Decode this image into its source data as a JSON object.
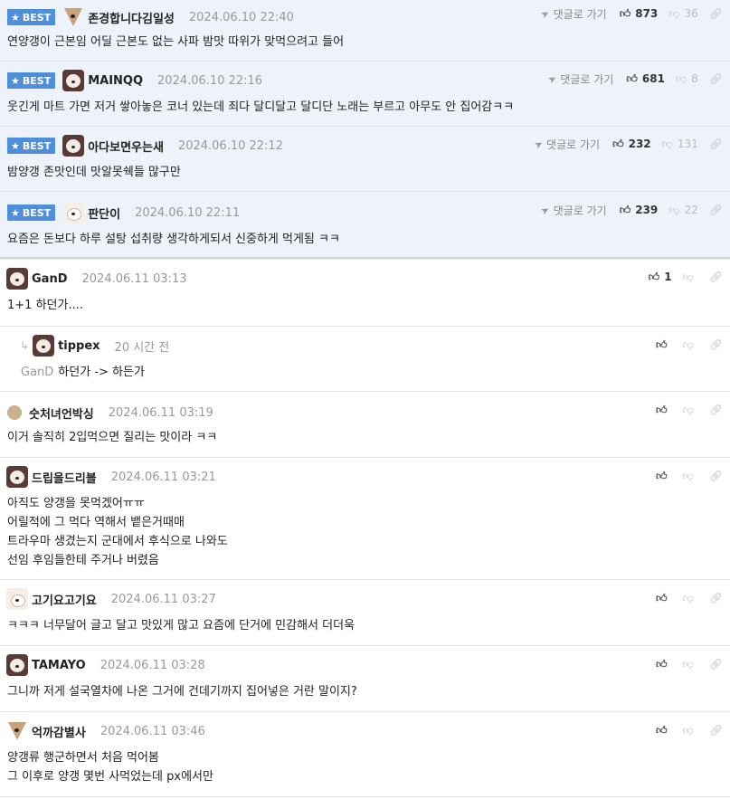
{
  "best_label": "BEST",
  "goto_label": "댓글로 가기",
  "best": [
    {
      "name": "존경합니다김일성",
      "date": "2024.06.10 22:40",
      "text": "연양갱이 근본임 어딜 근본도 없는 사파 밤맛 따위가 맞먹으려고 들어",
      "up": "873",
      "down": "36"
    },
    {
      "name": "MAINQQ",
      "date": "2024.06.10 22:16",
      "text": "웃긴게 마트 가면 저거 쌓아놓은 코너 있는데 죄다 달디달고 달디단 노래는 부르고 아무도 안 집어감ㅋㅋ",
      "up": "681",
      "down": "8"
    },
    {
      "name": "아다보면우는새",
      "date": "2024.06.10 22:12",
      "text": "밤양갱 존맛인데 맛알못쉑들 많구만",
      "up": "232",
      "down": "131"
    },
    {
      "name": "판단이",
      "date": "2024.06.10 22:11",
      "text": "요즘은 돈보다 하루 설탕 섭취량 생각하게되서 신중하게 먹게됨 ㅋㅋ",
      "up": "239",
      "down": "22"
    }
  ],
  "comments": [
    {
      "name": "GanD",
      "date": "2024.06.11 03:13",
      "lines": [
        "1+1 하던가...."
      ],
      "up": "1"
    },
    {
      "name": "tippex",
      "date": "20 시간 전",
      "reply_to": "GanD",
      "lines": [
        "하던가 -> 하든가"
      ]
    },
    {
      "name": "숫처녀언박싱",
      "date": "2024.06.11 03:19",
      "lines": [
        "이거 솔직히 2입먹으면 질리는 맛이라 ㅋㅋ"
      ]
    },
    {
      "name": "드립을드리블",
      "date": "2024.06.11 03:21",
      "lines": [
        "아직도 양갱을 못먹겠어ㅠㅠ",
        "어릴적에 그 먹다 역해서 뱉은거때매",
        "트라우마 생겼는지 군대에서 후식으로 나와도",
        "선임 후임들한테 주거나 버렸음"
      ]
    },
    {
      "name": "고기요고기요",
      "date": "2024.06.11 03:27",
      "lines": [
        "ㅋㅋㅋ 너무달어 글고 달고 맛있게 많고 요즘에 단거에 민감해서 더더욱"
      ]
    },
    {
      "name": "TAMAYO",
      "date": "2024.06.11 03:28",
      "lines": [
        "그니까 저게 설국열차에 나온 그거에 건데기까지 집어넣은 거란 말이지?"
      ]
    },
    {
      "name": "억까감별사",
      "date": "2024.06.11 03:46",
      "lines": [
        "양갱류 행군하면서 처음 먹어봄",
        "그 이후로 양갱 몇번 사먹었는데 px에서만"
      ]
    }
  ],
  "icons": {
    "upvote": "thumbs-up-icon",
    "downvote": "thumbs-down-icon",
    "link": "link-icon",
    "goto": "send-icon",
    "best": "star-icon",
    "reply": "reply-arrow-icon"
  }
}
